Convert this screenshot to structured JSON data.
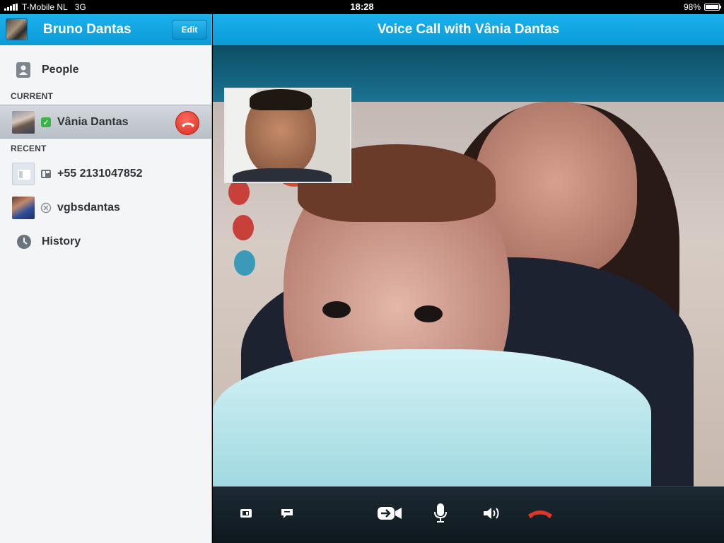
{
  "status_bar": {
    "carrier": "T-Mobile NL",
    "network": "3G",
    "time": "18:28",
    "battery": "98%",
    "battery_level": 0.98
  },
  "sidebar": {
    "user_name": "Bruno Dantas",
    "edit_label": "Edit",
    "people_label": "People",
    "current_title": "CURRENT",
    "current_contact": "Vânia Dantas",
    "recent_title": "RECENT",
    "recent": [
      {
        "name": "+55 2131047852",
        "icon": "phone-icon"
      },
      {
        "name": "vgbsdantas",
        "icon": "offline-status-icon"
      }
    ],
    "history_label": "History"
  },
  "call": {
    "title": "Voice Call with Vânia Dantas"
  },
  "controls": [
    {
      "name": "screen-toggle-button",
      "icon": "screen-icon"
    },
    {
      "name": "chat-button",
      "icon": "chat-icon"
    },
    {
      "name": "video-toggle-button",
      "icon": "video-camera-icon"
    },
    {
      "name": "mute-button",
      "icon": "microphone-icon"
    },
    {
      "name": "speaker-button",
      "icon": "speaker-icon"
    },
    {
      "name": "end-call-button",
      "icon": "hang-up-icon"
    }
  ],
  "colors": {
    "header_blue": "#0fa4e0",
    "hangup_red": "#e2352a",
    "presence_green": "#3bb34a"
  }
}
